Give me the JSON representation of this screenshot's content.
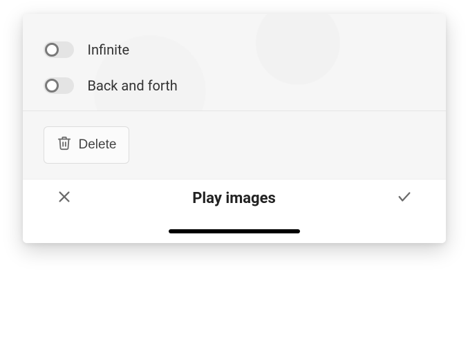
{
  "settings": {
    "infinite": {
      "label": "Infinite",
      "enabled": false
    },
    "backAndForth": {
      "label": "Back and forth",
      "enabled": false
    }
  },
  "actions": {
    "delete_label": "Delete"
  },
  "footer": {
    "title": "Play images"
  }
}
